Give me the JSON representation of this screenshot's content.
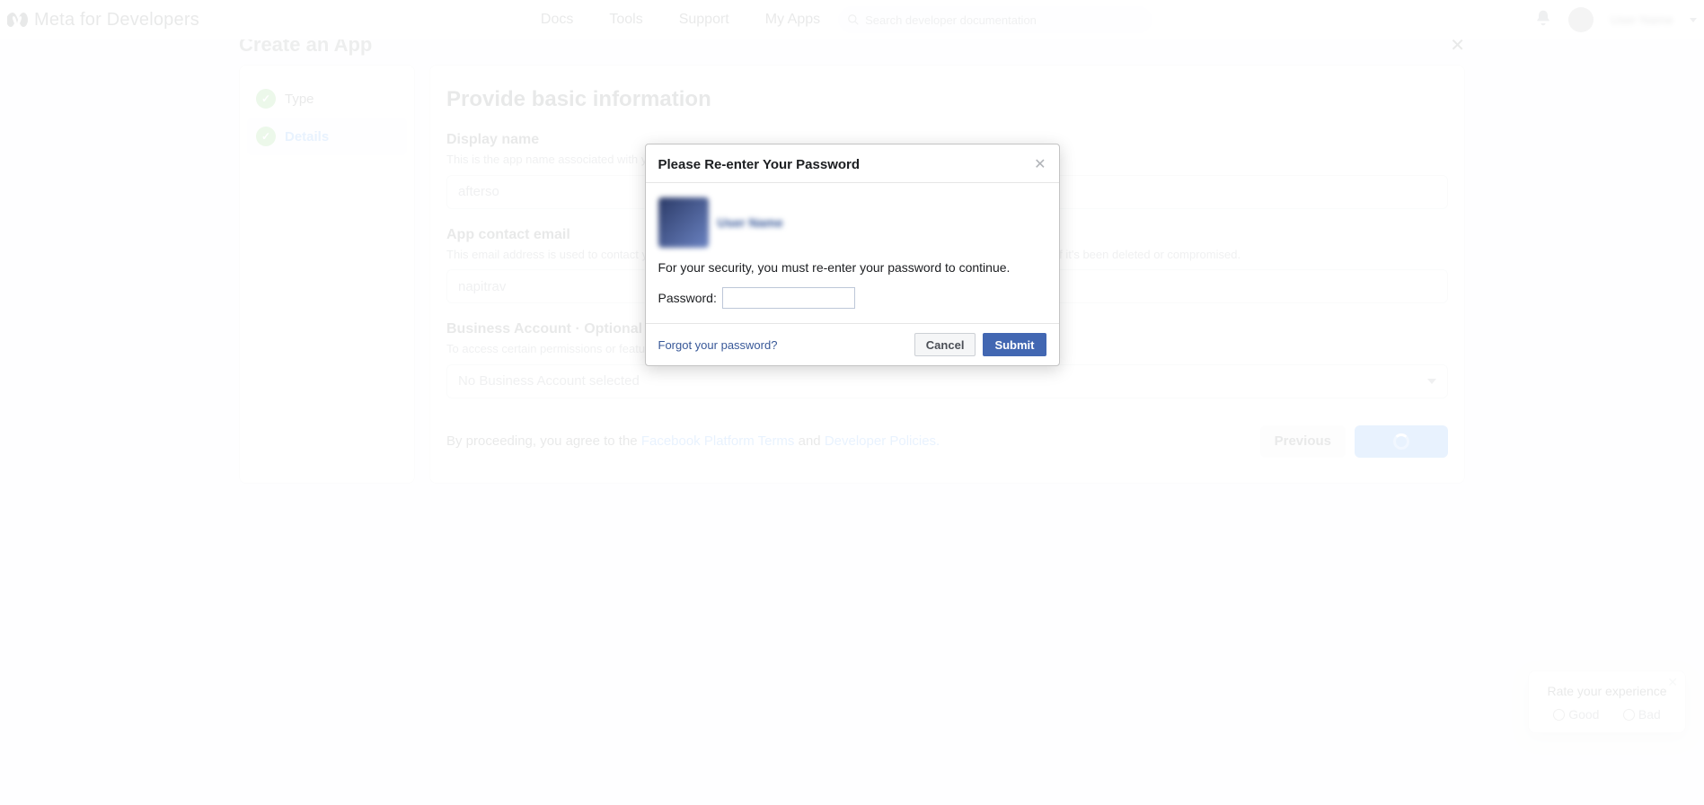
{
  "brand": {
    "text_main": "Meta",
    "text_sub": "for Developers"
  },
  "nav": {
    "docs": "Docs",
    "tools": "Tools",
    "support": "Support",
    "my_apps": "My Apps"
  },
  "search": {
    "placeholder": "Search developer documentation"
  },
  "user_top_name": "User Name",
  "page_title": "Create an App",
  "steps": {
    "type": "Type",
    "details": "Details"
  },
  "form": {
    "heading": "Provide basic information",
    "display_name": {
      "label": "Display name",
      "help": "This is the app name associated with your app ID. You can change this later.",
      "value": "afterso"
    },
    "contact_email": {
      "label": "App contact email",
      "help": "This email address is used to contact you about potential policy violations, app restrictions or steps to recover the app if it's been deleted or compromised.",
      "value": "napitrav"
    },
    "business_account": {
      "label": "Business Account · Optional",
      "help": "To access certain permissions or features, apps need to be connected to a Business Account.",
      "selected": "No Business Account selected"
    },
    "disclaimer_prefix": "By proceeding, you agree to the ",
    "disclaimer_link1": "Facebook Platform Terms",
    "disclaimer_and": " and ",
    "disclaimer_link2": "Developer Policies.",
    "previous": "Previous"
  },
  "feedback": {
    "title": "Rate your experience",
    "good": "Good",
    "bad": "Bad"
  },
  "modal": {
    "title": "Please Re-enter Your Password",
    "user_name": "User Name",
    "body_text": "For your security, you must re-enter your password to continue.",
    "password_label": "Password:",
    "forgot": "Forgot your password?",
    "cancel": "Cancel",
    "submit": "Submit"
  }
}
